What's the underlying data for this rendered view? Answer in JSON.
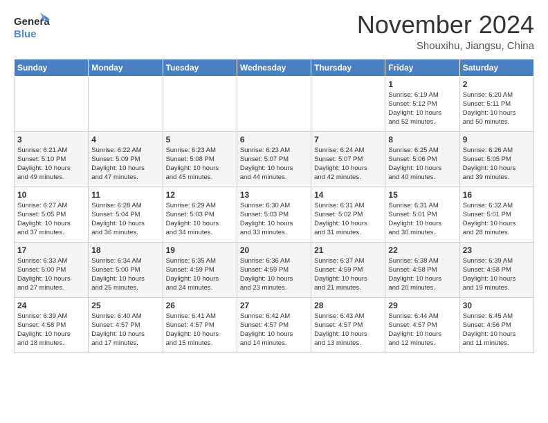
{
  "logo": {
    "general": "General",
    "blue": "Blue"
  },
  "title": "November 2024",
  "location": "Shouxihu, Jiangsu, China",
  "headers": [
    "Sunday",
    "Monday",
    "Tuesday",
    "Wednesday",
    "Thursday",
    "Friday",
    "Saturday"
  ],
  "weeks": [
    [
      {
        "day": "",
        "info": ""
      },
      {
        "day": "",
        "info": ""
      },
      {
        "day": "",
        "info": ""
      },
      {
        "day": "",
        "info": ""
      },
      {
        "day": "",
        "info": ""
      },
      {
        "day": "1",
        "info": "Sunrise: 6:19 AM\nSunset: 5:12 PM\nDaylight: 10 hours\nand 52 minutes."
      },
      {
        "day": "2",
        "info": "Sunrise: 6:20 AM\nSunset: 5:11 PM\nDaylight: 10 hours\nand 50 minutes."
      }
    ],
    [
      {
        "day": "3",
        "info": "Sunrise: 6:21 AM\nSunset: 5:10 PM\nDaylight: 10 hours\nand 49 minutes."
      },
      {
        "day": "4",
        "info": "Sunrise: 6:22 AM\nSunset: 5:09 PM\nDaylight: 10 hours\nand 47 minutes."
      },
      {
        "day": "5",
        "info": "Sunrise: 6:23 AM\nSunset: 5:08 PM\nDaylight: 10 hours\nand 45 minutes."
      },
      {
        "day": "6",
        "info": "Sunrise: 6:23 AM\nSunset: 5:07 PM\nDaylight: 10 hours\nand 44 minutes."
      },
      {
        "day": "7",
        "info": "Sunrise: 6:24 AM\nSunset: 5:07 PM\nDaylight: 10 hours\nand 42 minutes."
      },
      {
        "day": "8",
        "info": "Sunrise: 6:25 AM\nSunset: 5:06 PM\nDaylight: 10 hours\nand 40 minutes."
      },
      {
        "day": "9",
        "info": "Sunrise: 6:26 AM\nSunset: 5:05 PM\nDaylight: 10 hours\nand 39 minutes."
      }
    ],
    [
      {
        "day": "10",
        "info": "Sunrise: 6:27 AM\nSunset: 5:05 PM\nDaylight: 10 hours\nand 37 minutes."
      },
      {
        "day": "11",
        "info": "Sunrise: 6:28 AM\nSunset: 5:04 PM\nDaylight: 10 hours\nand 36 minutes."
      },
      {
        "day": "12",
        "info": "Sunrise: 6:29 AM\nSunset: 5:03 PM\nDaylight: 10 hours\nand 34 minutes."
      },
      {
        "day": "13",
        "info": "Sunrise: 6:30 AM\nSunset: 5:03 PM\nDaylight: 10 hours\nand 33 minutes."
      },
      {
        "day": "14",
        "info": "Sunrise: 6:31 AM\nSunset: 5:02 PM\nDaylight: 10 hours\nand 31 minutes."
      },
      {
        "day": "15",
        "info": "Sunrise: 6:31 AM\nSunset: 5:01 PM\nDaylight: 10 hours\nand 30 minutes."
      },
      {
        "day": "16",
        "info": "Sunrise: 6:32 AM\nSunset: 5:01 PM\nDaylight: 10 hours\nand 28 minutes."
      }
    ],
    [
      {
        "day": "17",
        "info": "Sunrise: 6:33 AM\nSunset: 5:00 PM\nDaylight: 10 hours\nand 27 minutes."
      },
      {
        "day": "18",
        "info": "Sunrise: 6:34 AM\nSunset: 5:00 PM\nDaylight: 10 hours\nand 25 minutes."
      },
      {
        "day": "19",
        "info": "Sunrise: 6:35 AM\nSunset: 4:59 PM\nDaylight: 10 hours\nand 24 minutes."
      },
      {
        "day": "20",
        "info": "Sunrise: 6:36 AM\nSunset: 4:59 PM\nDaylight: 10 hours\nand 23 minutes."
      },
      {
        "day": "21",
        "info": "Sunrise: 6:37 AM\nSunset: 4:59 PM\nDaylight: 10 hours\nand 21 minutes."
      },
      {
        "day": "22",
        "info": "Sunrise: 6:38 AM\nSunset: 4:58 PM\nDaylight: 10 hours\nand 20 minutes."
      },
      {
        "day": "23",
        "info": "Sunrise: 6:39 AM\nSunset: 4:58 PM\nDaylight: 10 hours\nand 19 minutes."
      }
    ],
    [
      {
        "day": "24",
        "info": "Sunrise: 6:39 AM\nSunset: 4:58 PM\nDaylight: 10 hours\nand 18 minutes."
      },
      {
        "day": "25",
        "info": "Sunrise: 6:40 AM\nSunset: 4:57 PM\nDaylight: 10 hours\nand 17 minutes."
      },
      {
        "day": "26",
        "info": "Sunrise: 6:41 AM\nSunset: 4:57 PM\nDaylight: 10 hours\nand 15 minutes."
      },
      {
        "day": "27",
        "info": "Sunrise: 6:42 AM\nSunset: 4:57 PM\nDaylight: 10 hours\nand 14 minutes."
      },
      {
        "day": "28",
        "info": "Sunrise: 6:43 AM\nSunset: 4:57 PM\nDaylight: 10 hours\nand 13 minutes."
      },
      {
        "day": "29",
        "info": "Sunrise: 6:44 AM\nSunset: 4:57 PM\nDaylight: 10 hours\nand 12 minutes."
      },
      {
        "day": "30",
        "info": "Sunrise: 6:45 AM\nSunset: 4:56 PM\nDaylight: 10 hours\nand 11 minutes."
      }
    ]
  ]
}
